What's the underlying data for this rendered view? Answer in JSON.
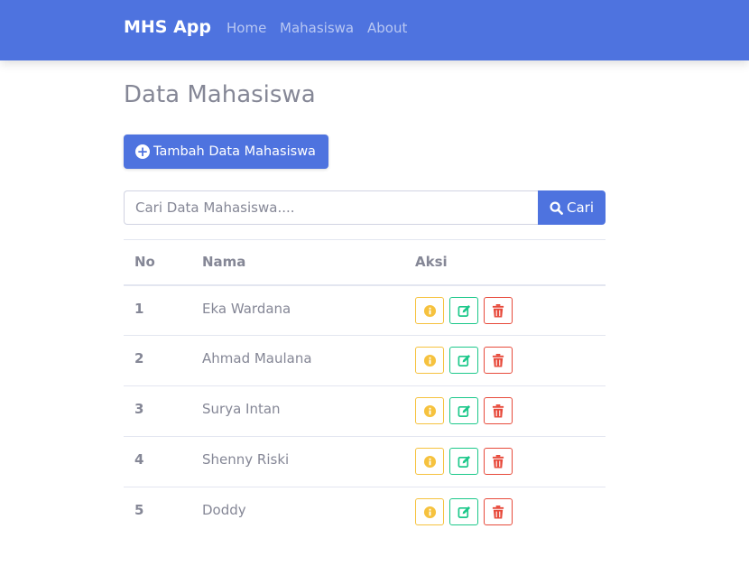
{
  "navbar": {
    "brand": "MHS App",
    "links": [
      "Home",
      "Mahasiswa",
      "About"
    ]
  },
  "main": {
    "title": "Data Mahasiswa",
    "add_button": "Tambah Data Mahasiswa",
    "search": {
      "placeholder": "Cari Data Mahasiswa....",
      "value": "",
      "button": "Cari"
    },
    "table": {
      "headers": [
        "No",
        "Nama",
        "Aksi"
      ],
      "rows": [
        {
          "no": "1",
          "nama": "Eka Wardana"
        },
        {
          "no": "2",
          "nama": "Ahmad Maulana"
        },
        {
          "no": "3",
          "nama": "Surya Intan"
        },
        {
          "no": "4",
          "nama": "Shenny Riski"
        },
        {
          "no": "5",
          "nama": "Doddy"
        }
      ],
      "actions": [
        {
          "icon": "info-icon",
          "color": "#f6c23e"
        },
        {
          "icon": "edit-icon",
          "color": "#1cc88a"
        },
        {
          "icon": "trash-icon",
          "color": "#e74a3b"
        }
      ]
    }
  },
  "colors": {
    "primary": "#4e73df",
    "warning": "#f6c23e",
    "success": "#1cc88a",
    "danger": "#e74a3b",
    "text": "#858796"
  }
}
